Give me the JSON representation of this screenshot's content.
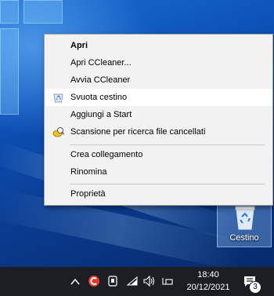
{
  "context_menu": {
    "items": [
      {
        "label": "Apri",
        "bold": true
      },
      {
        "label": "Apri CCleaner..."
      },
      {
        "label": "Avvia CCleaner"
      },
      {
        "label": "Svuota cestino",
        "icon": "recycle-bin-icon",
        "highlighted": true
      },
      {
        "label": "Aggiungi a Start"
      },
      {
        "label": "Scansione per ricerca file cancellati",
        "icon": "recuva-icon"
      },
      {
        "label": "Crea collegamento"
      },
      {
        "label": "Rinomina"
      },
      {
        "label": "Proprietà"
      }
    ]
  },
  "desktop": {
    "recycle_bin_label": "Cestino"
  },
  "taskbar": {
    "time": "18:40",
    "date": "20/12/2021",
    "notification_count": "3",
    "tray_icons": [
      "chevron-up-icon",
      "ccleaner-tray-icon",
      "meet-now-icon",
      "wifi-icon",
      "volume-icon",
      "keyboard-icon",
      "action-center-icon"
    ]
  },
  "colors": {
    "menu_bg": "#f2f2f2",
    "menu_highlight": "#ffffff",
    "taskbar_bg": "#1b1f24",
    "desktop_blue": "#0c4fb5"
  }
}
